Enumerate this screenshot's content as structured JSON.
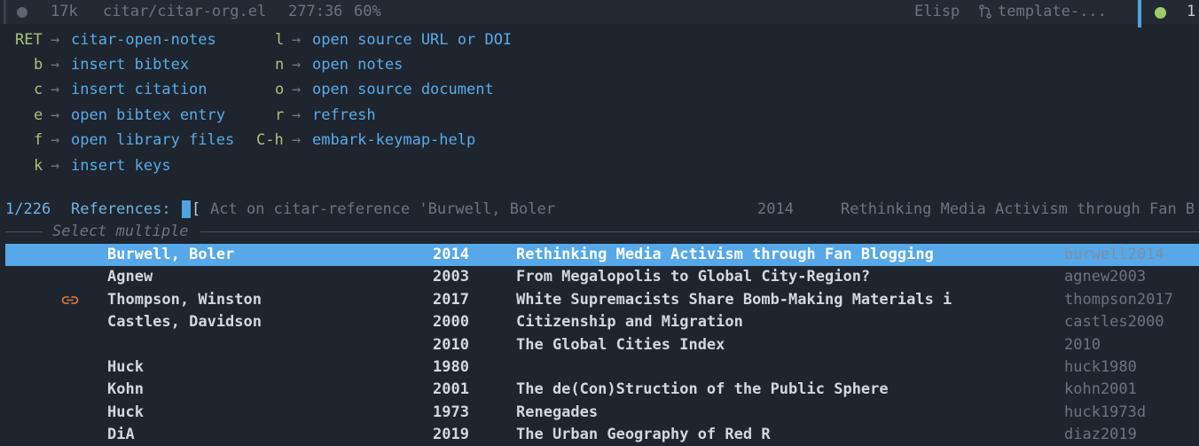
{
  "modeline": {
    "size": "17k",
    "file": "citar/citar-org.el",
    "position": "277:36",
    "percent": "60%",
    "mode": "Elisp",
    "branch": "template-...",
    "right_digit": "1"
  },
  "whichkey": {
    "left": [
      {
        "key": "RET",
        "cmd": "citar-open-notes"
      },
      {
        "key": "b",
        "cmd": "insert bibtex"
      },
      {
        "key": "c",
        "cmd": "insert citation"
      },
      {
        "key": "e",
        "cmd": "open bibtex entry"
      },
      {
        "key": "f",
        "cmd": "open library files"
      },
      {
        "key": "k",
        "cmd": "insert keys"
      }
    ],
    "right": [
      {
        "key": "l",
        "cmd": "open source URL or DOI"
      },
      {
        "key": "n",
        "cmd": "open notes"
      },
      {
        "key": "o",
        "cmd": "open source document"
      },
      {
        "key": "r",
        "cmd": "refresh"
      },
      {
        "key": "C-h",
        "cmd": "embark-keymap-help"
      }
    ],
    "arrow": "→"
  },
  "minibuffer": {
    "count": "1/226",
    "label": "References:",
    "bracket": "[",
    "hint": "Act on citar-reference 'Burwell, Boler",
    "hint_year": "2014",
    "hint_title": "Rethinking Media Activism through Fan B"
  },
  "select_multiple": "Select multiple",
  "candidates": [
    {
      "author": "Burwell, Boler",
      "year": "2014",
      "title": "Rethinking Media Activism through Fan Blogging",
      "key": "burwell2014",
      "selected": true,
      "link": false
    },
    {
      "author": "Agnew",
      "year": "2003",
      "title": "From Megalopolis to Global City-Region?",
      "key": "agnew2003",
      "selected": false,
      "link": false
    },
    {
      "author": "Thompson, Winston",
      "year": "2017",
      "title": "White Supremacists Share Bomb-Making Materials i",
      "key": "thompson2017",
      "selected": false,
      "link": true
    },
    {
      "author": "Castles, Davidson",
      "year": "2000",
      "title": "Citizenship and Migration",
      "key": "castles2000",
      "selected": false,
      "link": false
    },
    {
      "author": "",
      "year": "2010",
      "title": "The Global Cities Index",
      "key": "2010",
      "selected": false,
      "link": false
    },
    {
      "author": "Huck",
      "year": "1980",
      "title": "",
      "key": "huck1980",
      "selected": false,
      "link": false
    },
    {
      "author": "Kohn",
      "year": "2001",
      "title": "The de(Con)Struction of the Public Sphere",
      "key": "kohn2001",
      "selected": false,
      "link": false
    },
    {
      "author": "Huck",
      "year": "1973",
      "title": "Renegades",
      "key": "huck1973d",
      "selected": false,
      "link": false
    },
    {
      "author": "DiA",
      "year": "2019",
      "title": "The Urban Geography of Red R",
      "key": "diaz2019",
      "selected": false,
      "link": false
    }
  ],
  "colors": {
    "background": "#1e252e",
    "selection": "#56a8e8",
    "key": "#a7c47a",
    "command": "#5aabe8",
    "link_icon": "#e0803a"
  }
}
